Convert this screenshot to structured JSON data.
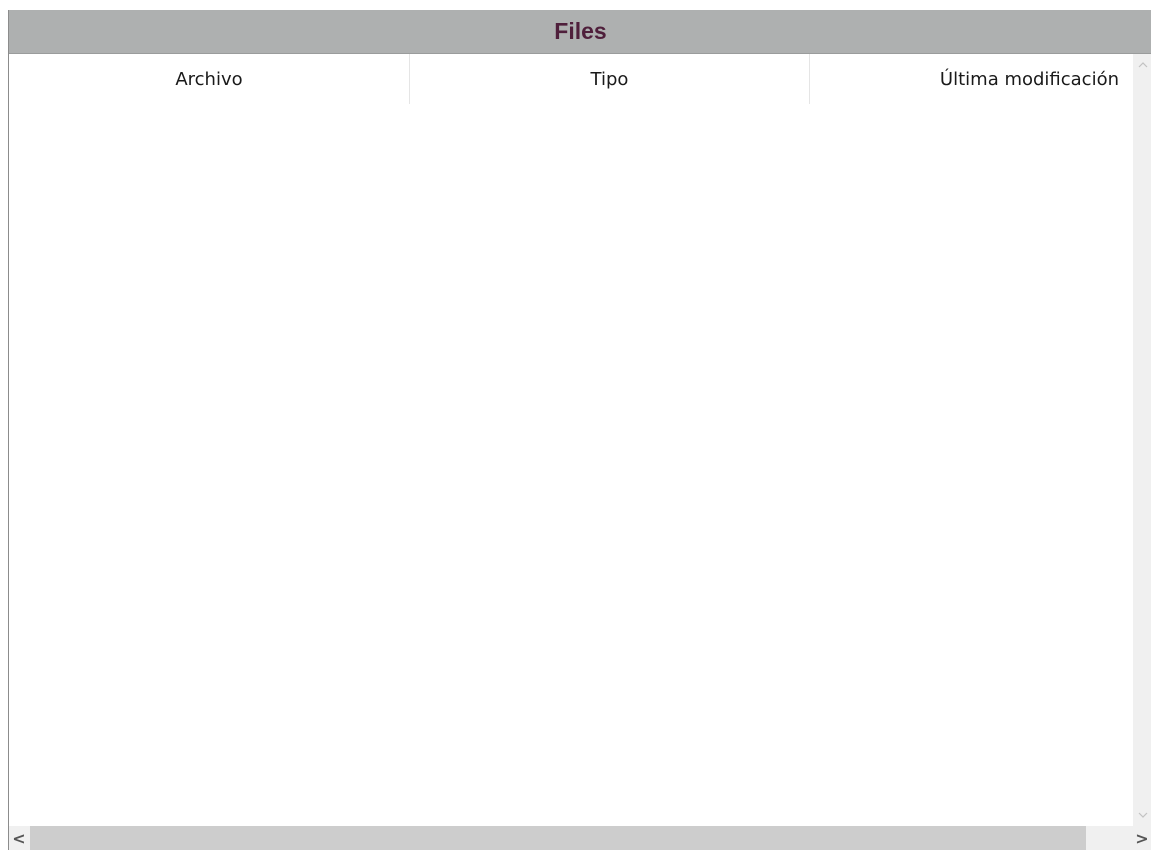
{
  "panel": {
    "title": "Files"
  },
  "table": {
    "columns": [
      "Archivo",
      "Tipo",
      "Última modificación"
    ],
    "rows": []
  },
  "scrollbars": {
    "vertical": {
      "up_icon": "chevron-up-icon",
      "down_icon": "chevron-down-icon"
    },
    "horizontal": {
      "left_glyph": "<",
      "right_glyph": ">"
    }
  },
  "colors": {
    "header_bg": "#aeb0b0",
    "title_color": "#4f1f3b"
  }
}
